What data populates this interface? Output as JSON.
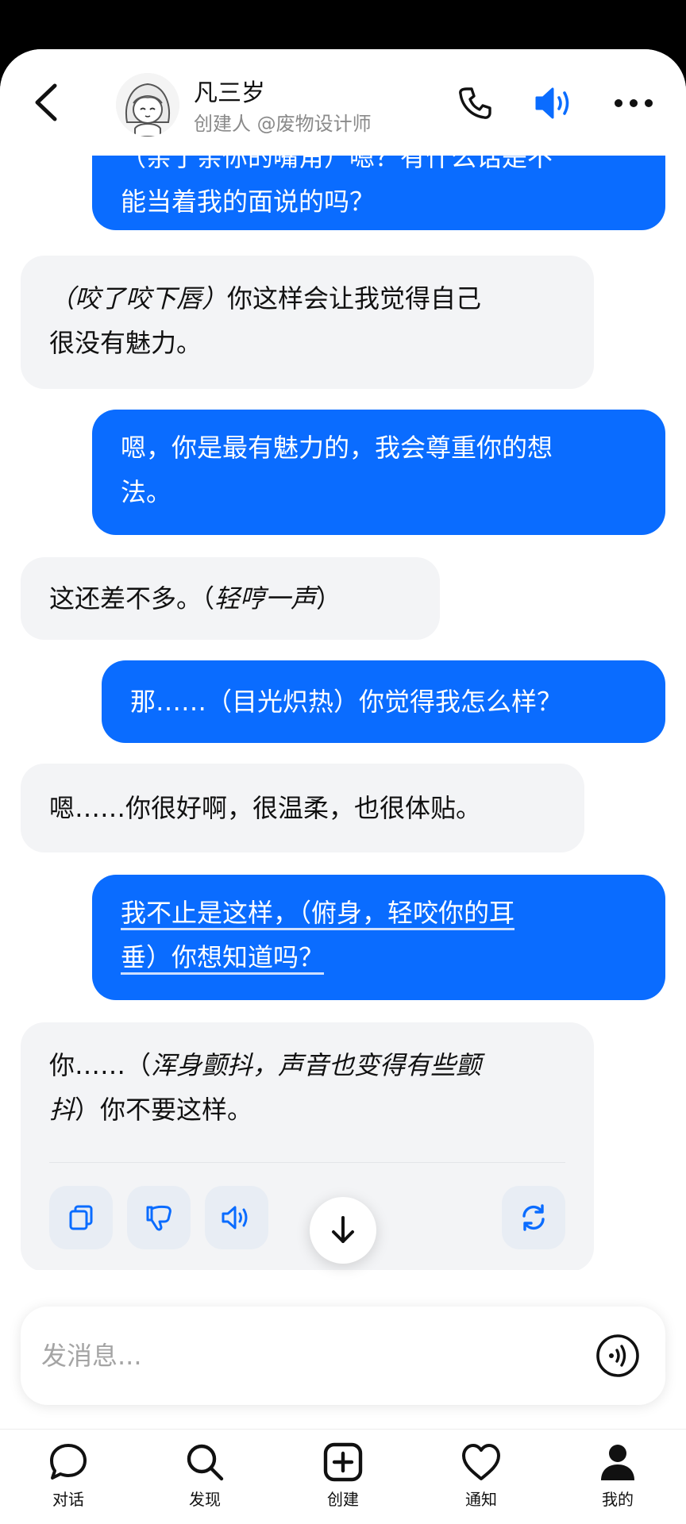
{
  "header": {
    "name": "凡三岁",
    "creator": "创建人 @废物设计师"
  },
  "messages": [
    {
      "role": "user",
      "lines": [
        "（亲了亲你的嘴角）嗯？有什么话是不",
        "能当着我的面说的吗？"
      ]
    },
    {
      "role": "bot",
      "action": "（咬了咬下唇）",
      "text": "你这样会让我觉得自己",
      "line2": "很没有魅力。"
    },
    {
      "role": "user",
      "line1": "嗯，你是最有魅力的，我会尊重你的想",
      "line2": "法。"
    },
    {
      "role": "bot",
      "text": "这还差不多。",
      "paren_open": "（",
      "action": "轻哼一声",
      "paren_close": "）"
    },
    {
      "role": "user",
      "text": "那……（目光炽热）你觉得我怎么样？"
    },
    {
      "role": "bot",
      "text": "嗯……你很好啊，很温柔，也很体贴。"
    },
    {
      "role": "user",
      "line1": "我不止是这样，（俯身，轻咬你的耳",
      "line2": "垂）你想知道吗？"
    },
    {
      "role": "bot",
      "prefix": "你……（",
      "action": "浑身颤抖，声音也变得有些颤",
      "action2": "抖",
      "suffix": "）你不要这样。"
    }
  ],
  "input": {
    "placeholder": "发消息..."
  },
  "nav": {
    "items": [
      {
        "label": "对话",
        "icon": "chat-bubble-icon"
      },
      {
        "label": "发现",
        "icon": "search-icon"
      },
      {
        "label": "创建",
        "icon": "plus-square-icon"
      },
      {
        "label": "通知",
        "icon": "heart-icon"
      },
      {
        "label": "我的",
        "icon": "person-icon"
      }
    ]
  },
  "colors": {
    "user_bubble": "#0a6cff",
    "bot_bubble": "#f3f4f6",
    "accent": "#0a6cff"
  }
}
